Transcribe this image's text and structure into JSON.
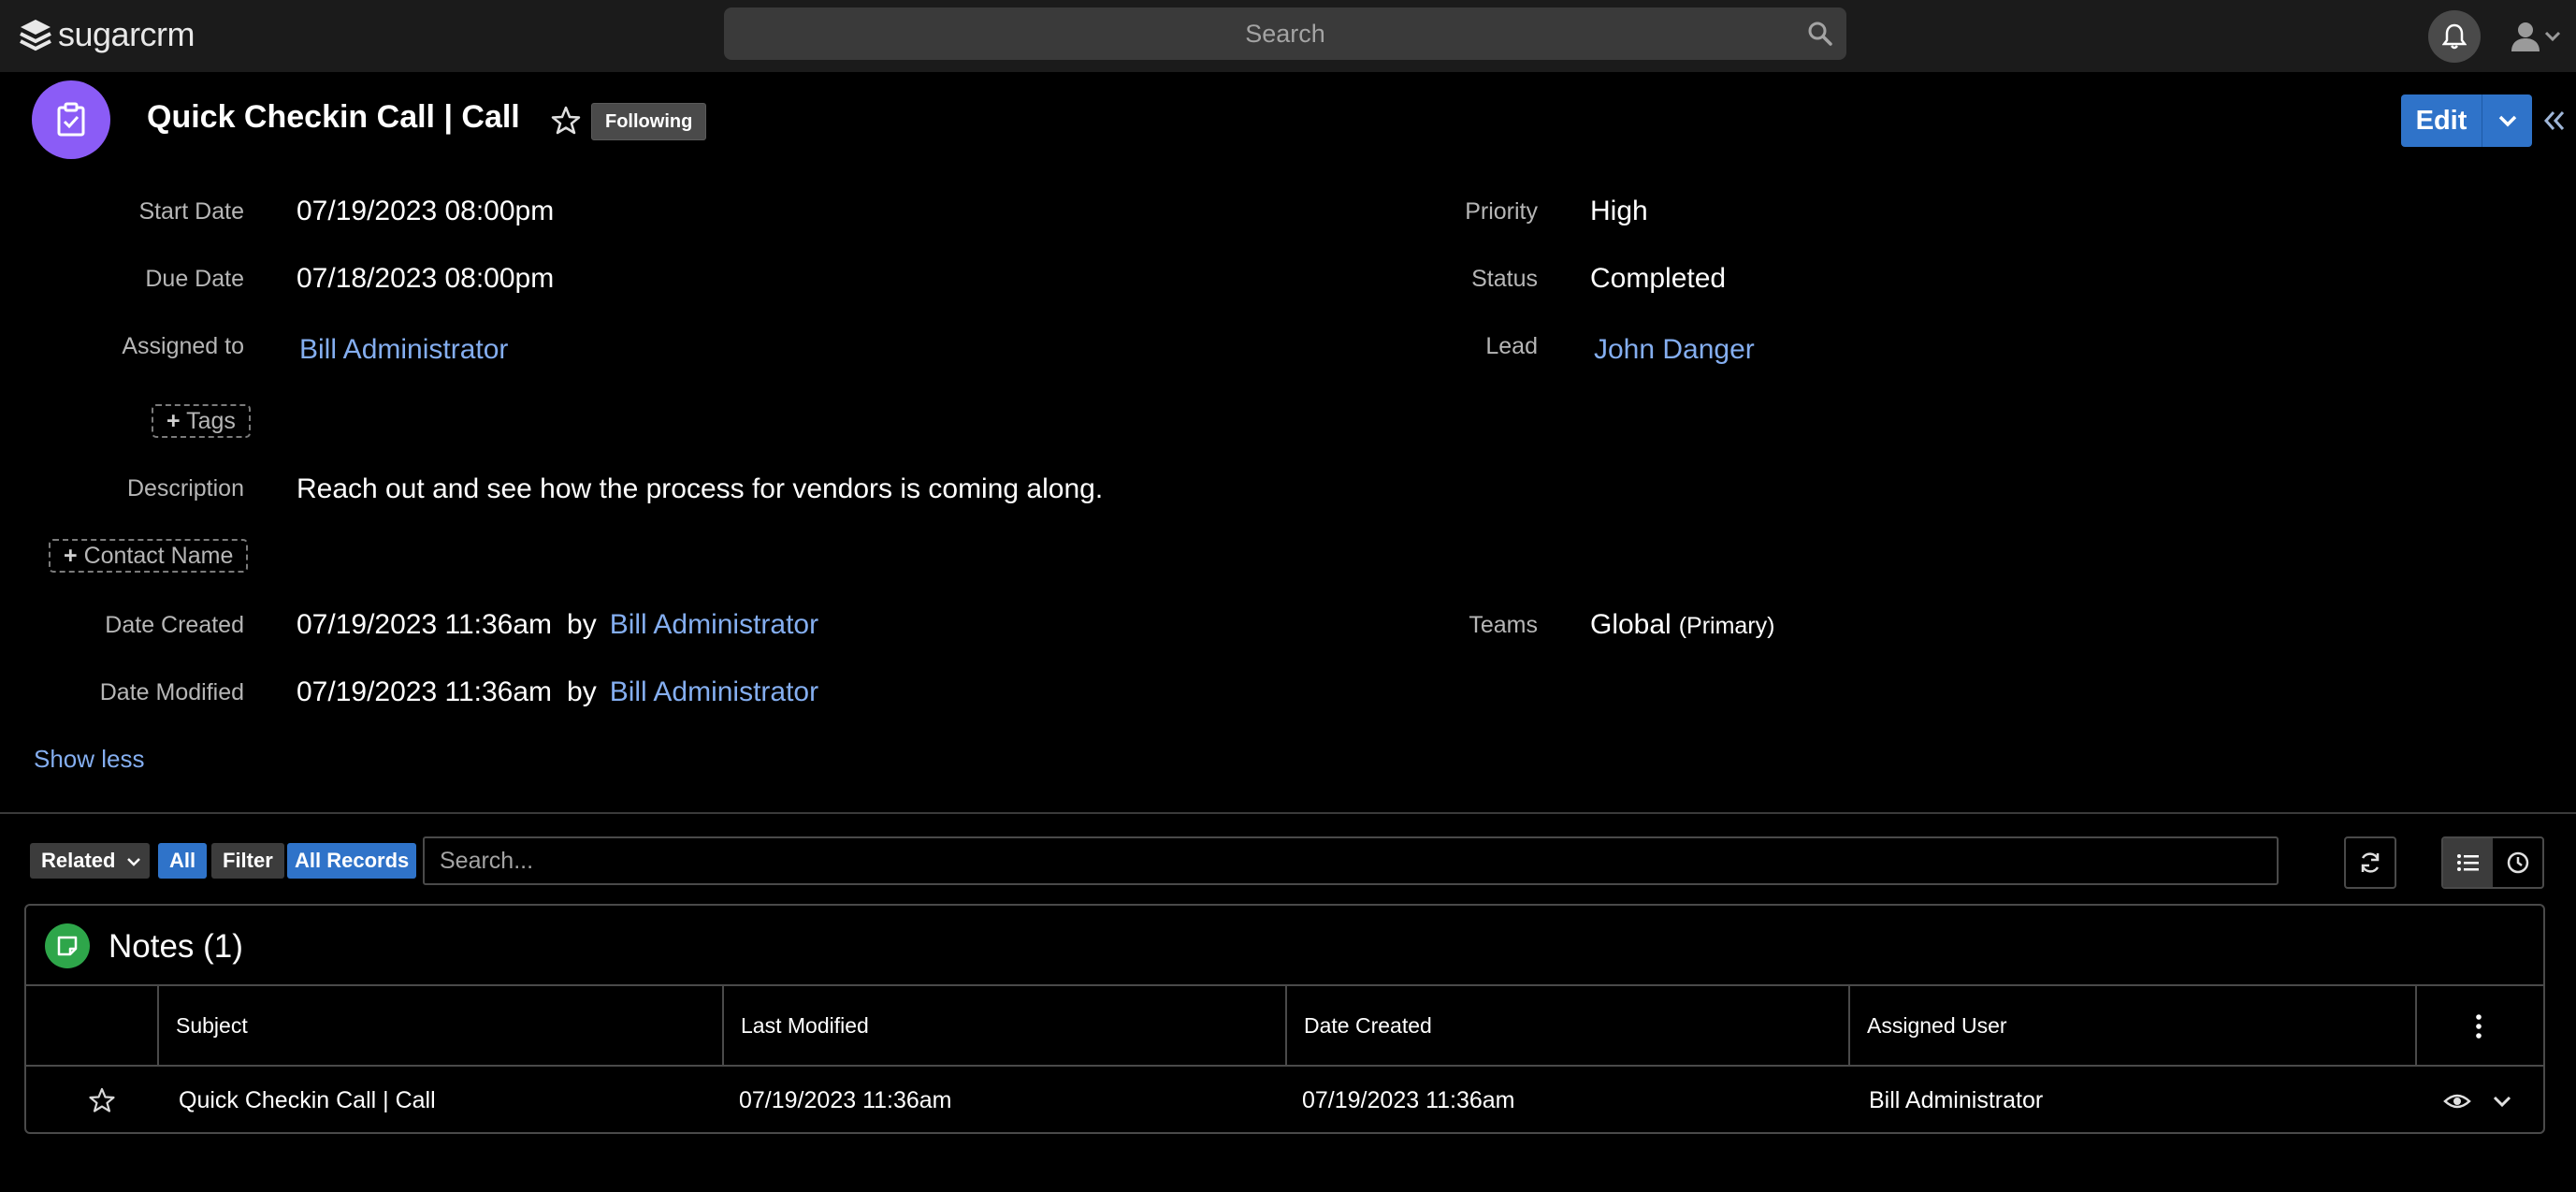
{
  "topbar": {
    "logo_text": "sugarcrm",
    "search_placeholder": "Search"
  },
  "record": {
    "title": "Quick Checkin Call | Call",
    "following_label": "Following",
    "edit_label": "Edit"
  },
  "fields": {
    "start_date": {
      "label": "Start Date",
      "value": "07/19/2023 08:00pm"
    },
    "due_date": {
      "label": "Due Date",
      "value": "07/18/2023 08:00pm"
    },
    "assigned_to": {
      "label": "Assigned to",
      "value": "Bill Administrator"
    },
    "tags_label": "Tags",
    "description": {
      "label": "Description",
      "value": "Reach out and see how the process for vendors is coming along."
    },
    "contact_name_label": "Contact Name",
    "date_created": {
      "label": "Date Created",
      "value": "07/19/2023 11:36am",
      "by": "by",
      "user": "Bill Administrator"
    },
    "date_modified": {
      "label": "Date Modified",
      "value": "07/19/2023 11:36am",
      "by": "by",
      "user": "Bill Administrator"
    },
    "priority": {
      "label": "Priority",
      "value": "High"
    },
    "status": {
      "label": "Status",
      "value": "Completed"
    },
    "lead": {
      "label": "Lead",
      "value": "John Danger"
    },
    "teams": {
      "label": "Teams",
      "value": "Global",
      "suffix": "(Primary)"
    }
  },
  "show_less": "Show less",
  "subpanel_toolbar": {
    "related_label": "Related",
    "all_label": "All",
    "filter_label": "Filter",
    "all_records_label": "All Records",
    "search_placeholder": "Search..."
  },
  "notes": {
    "title": "Notes (1)",
    "columns": [
      "Subject",
      "Last Modified",
      "Date Created",
      "Assigned User"
    ],
    "rows": [
      {
        "subject": "Quick Checkin Call | Call",
        "last_modified": "07/19/2023 11:36am",
        "date_created": "07/19/2023 11:36am",
        "assigned_user": "Bill Administrator"
      }
    ]
  },
  "colors": {
    "accent": "#2f73c9",
    "link": "#84aef0",
    "calls_module": "#8b5cf6",
    "notes_module": "#2ea64a"
  },
  "icons": [
    "sugarcrm-logo-icon",
    "search-icon",
    "bell-icon",
    "user-icon",
    "chevron-down-icon",
    "calls-module-icon",
    "star-icon",
    "double-chevron-left-icon",
    "plus-icon",
    "refresh-icon",
    "list-view-icon",
    "clock-icon",
    "notes-module-icon",
    "kebab-menu-icon",
    "eye-icon"
  ]
}
